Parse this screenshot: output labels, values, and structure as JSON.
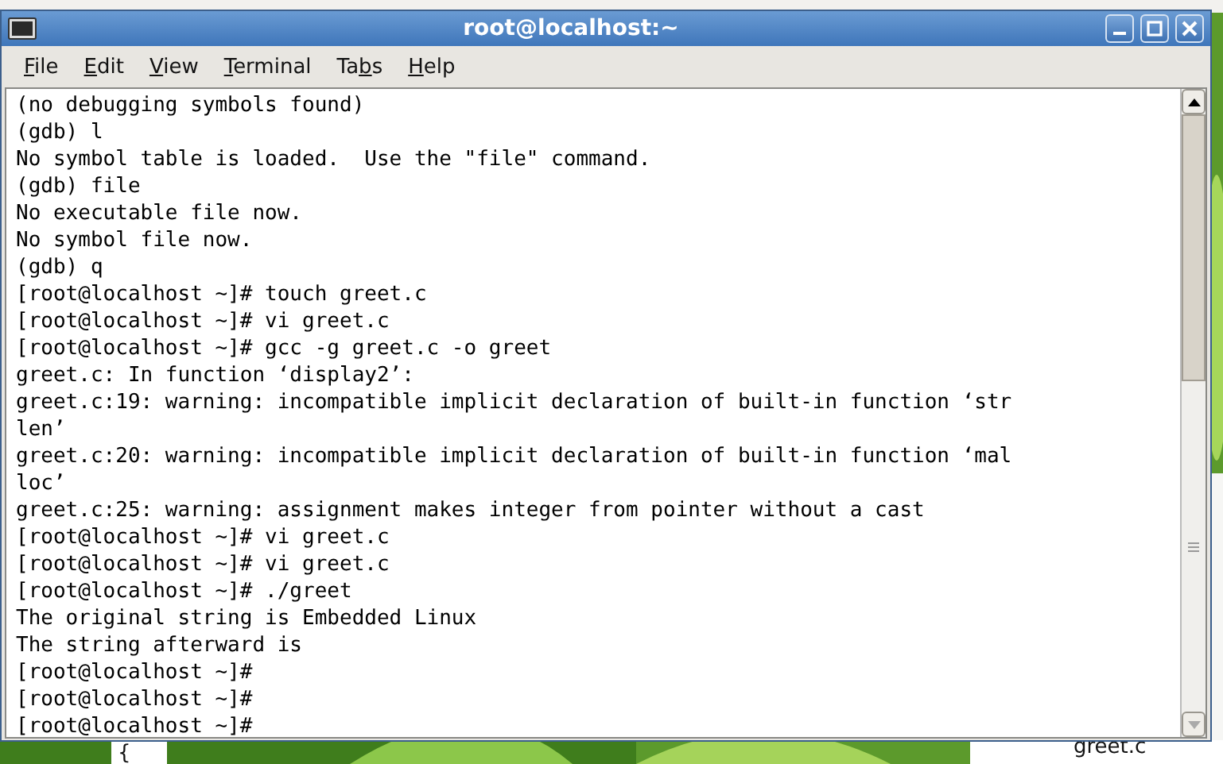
{
  "window": {
    "title": "root@localhost:~"
  },
  "menu": [
    {
      "key": "F",
      "rest": "ile"
    },
    {
      "key": "E",
      "rest": "dit"
    },
    {
      "key": "V",
      "rest": "iew"
    },
    {
      "key": "T",
      "rest": "erminal"
    },
    {
      "before": "Ta",
      "key": "b",
      "rest": "s"
    },
    {
      "key": "H",
      "rest": "elp"
    }
  ],
  "terminal": {
    "lines": [
      "(no debugging symbols found)",
      "(gdb) l",
      "No symbol table is loaded.  Use the \"file\" command.",
      "(gdb) file",
      "No executable file now.",
      "No symbol file now.",
      "(gdb) q",
      "[root@localhost ~]# touch greet.c",
      "[root@localhost ~]# vi greet.c",
      "[root@localhost ~]# gcc -g greet.c -o greet",
      "greet.c: In function ‘display2’:",
      "greet.c:19: warning: incompatible implicit declaration of built-in function ‘str",
      "len’",
      "greet.c:20: warning: incompatible implicit declaration of built-in function ‘mal",
      "loc’",
      "greet.c:25: warning: assignment makes integer from pointer without a cast",
      "[root@localhost ~]# vi greet.c",
      "[root@localhost ~]# vi greet.c",
      "[root@localhost ~]# ./greet",
      "The original string is Embedded Linux",
      "The string afterward is",
      "[root@localhost ~]#",
      "[root@localhost ~]#",
      "[root@localhost ~]#"
    ]
  },
  "background": {
    "editor_text": "{",
    "file_label": "greet.c"
  }
}
